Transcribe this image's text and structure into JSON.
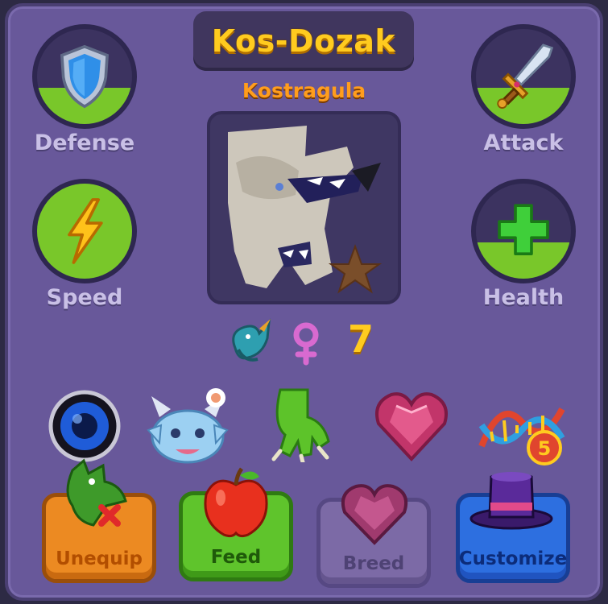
{
  "title": "Kos-Dozak",
  "species": "Kostragula",
  "level": "7",
  "stats": {
    "defense": {
      "label": "Defense",
      "fill": 0.38
    },
    "attack": {
      "label": "Attack",
      "fill": 0.38
    },
    "speed": {
      "label": "Speed",
      "fill": 1.0
    },
    "health": {
      "label": "Health",
      "fill": 0.38
    }
  },
  "gene_badge": "5",
  "buttons": {
    "unequip": "Unequip",
    "feed": "Feed",
    "breed": "Breed",
    "customize": "Customize"
  },
  "colors": {
    "panel": "#68589a",
    "stat_fill": "#79c72a",
    "title": "#ffcb1f",
    "subtitle": "#ff9d1d"
  }
}
